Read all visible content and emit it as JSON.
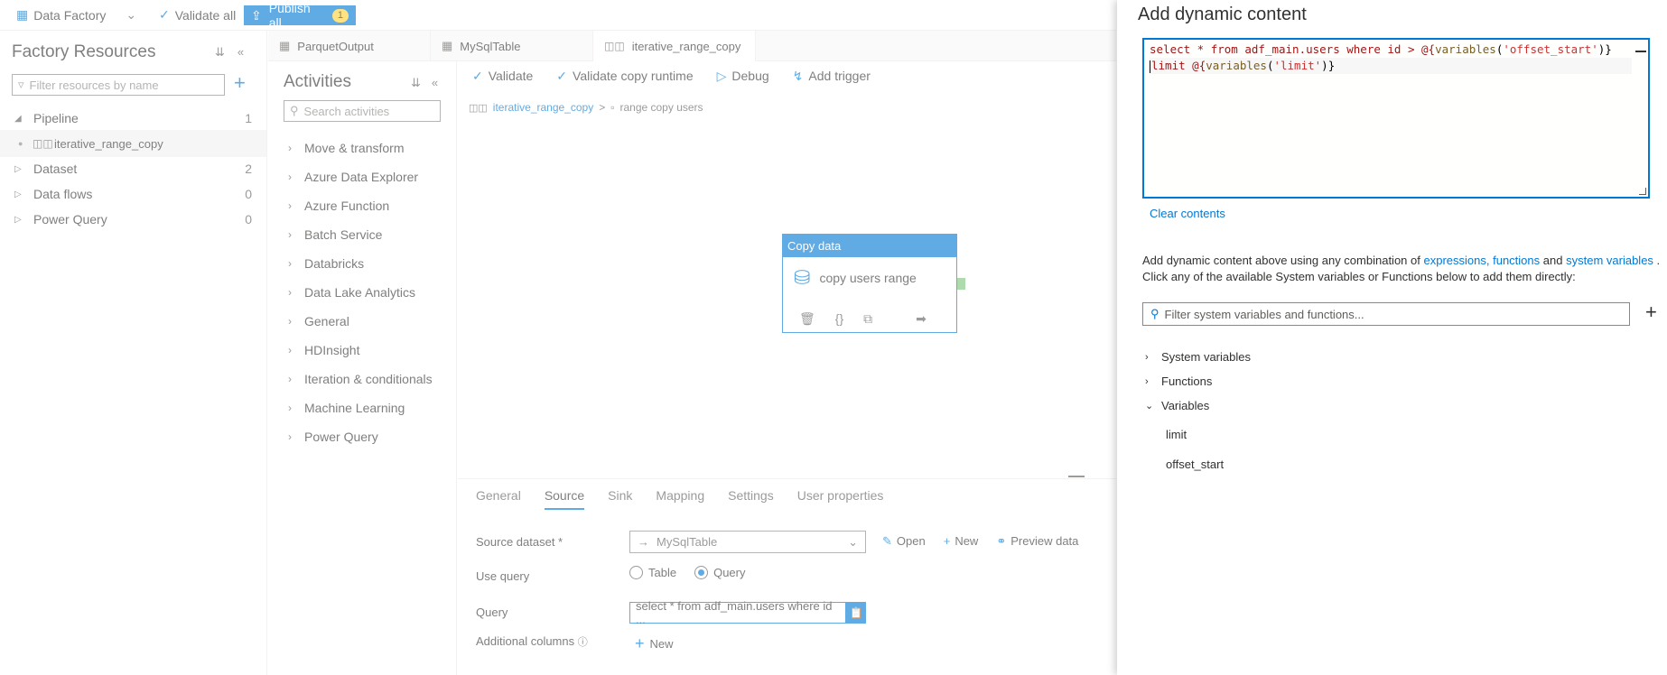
{
  "topbar": {
    "factory_label": "Data Factory",
    "validate_all": "Validate all",
    "publish_all": "Publish all",
    "publish_count": "1"
  },
  "resources": {
    "title": "Factory Resources",
    "filter_placeholder": "Filter resources by name",
    "items": [
      {
        "label": "Pipeline",
        "count": "1"
      },
      {
        "label": "iterative_range_copy",
        "count": ""
      },
      {
        "label": "Dataset",
        "count": "2"
      },
      {
        "label": "Data flows",
        "count": "0"
      },
      {
        "label": "Power Query",
        "count": "0"
      }
    ]
  },
  "tabs": [
    {
      "label": "ParquetOutput"
    },
    {
      "label": "MySqlTable"
    },
    {
      "label": "iterative_range_copy"
    }
  ],
  "activities": {
    "title": "Activities",
    "search_placeholder": "Search activities",
    "items": [
      "Move & transform",
      "Azure Data Explorer",
      "Azure Function",
      "Batch Service",
      "Databricks",
      "Data Lake Analytics",
      "General",
      "HDInsight",
      "Iteration & conditionals",
      "Machine Learning",
      "Power Query"
    ]
  },
  "canvas": {
    "toolbar": {
      "validate": "Validate",
      "validate_copy": "Validate copy runtime",
      "debug": "Debug",
      "add_trigger": "Add trigger"
    },
    "breadcrumb": {
      "pipeline": "iterative_range_copy",
      "sep": ">",
      "activity": "range copy users"
    },
    "node": {
      "header": "Copy data",
      "name": "copy users range"
    }
  },
  "bottom": {
    "tabs": [
      "General",
      "Source",
      "Sink",
      "Mapping",
      "Settings",
      "User properties"
    ],
    "source_dataset_label": "Source dataset *",
    "source_dataset_value": "MySqlTable",
    "open": "Open",
    "new": "New",
    "preview": "Preview data",
    "use_query_label": "Use query",
    "radio_table": "Table",
    "radio_query": "Query",
    "query_label": "Query",
    "query_value": "select * from adf_main.users where id ...",
    "additional_columns_label": "Additional columns",
    "additional_new": "New"
  },
  "dynamic": {
    "title": "Add dynamic content",
    "line1": {
      "select": "select",
      "mid": " * from adf_main.users where id > @{",
      "fn": "variables",
      "open": "(",
      "arg": "'offset_start'",
      "close": ")}"
    },
    "line2": {
      "kw": "limit",
      "mid": " @{",
      "fn": "variables",
      "open": "(",
      "arg": "'limit'",
      "close": ")}"
    },
    "clear_contents": "Clear contents",
    "help_prefix": "Add dynamic content above using any combination of",
    "help_expr": "expressions,",
    "help_funcs": "functions",
    "help_and": "and",
    "help_sysvars": "system variables",
    "help_suffix": ".",
    "help_line2": "Click any of the available System variables or Functions below to add them directly:",
    "filter_placeholder": "Filter system variables and functions...",
    "sections": [
      "System variables",
      "Functions",
      "Variables"
    ],
    "variables": [
      "limit",
      "offset_start"
    ]
  }
}
